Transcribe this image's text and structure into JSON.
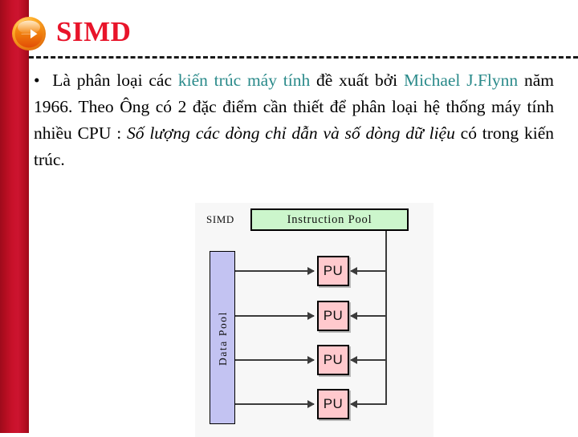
{
  "slide": {
    "title": "SIMD",
    "bullet_icon": "arrow-right-circle-icon",
    "accent_color": "#c8112a",
    "title_color": "#e8142a",
    "link_color": "#2a8a8a"
  },
  "body": {
    "bullet": "•",
    "runs": [
      {
        "text": "Là phân loại các ",
        "style": "normal"
      },
      {
        "text": "kiến trúc máy tính",
        "style": "teal"
      },
      {
        "text": " đề xuất bởi ",
        "style": "normal"
      },
      {
        "text": "Michael J.Flynn",
        "style": "teal"
      },
      {
        "text": " năm 1966. Theo Ông có 2 đặc điểm cần thiết để phân loại hệ thống máy tính nhiều CPU : ",
        "style": "normal"
      },
      {
        "text": "Số lượng các dòng chỉ dẫn và số dòng dữ liệu",
        "style": "italic"
      },
      {
        "text": " có trong kiến trúc.",
        "style": "normal"
      }
    ],
    "full_text": "• Là phân loại các kiến trúc máy tính đề xuất bởi Michael J.Flynn năm 1966. Theo Ông có 2 đặc điểm cần thiết để phân loại hệ thống máy tính nhiều CPU : Số lượng các dòng chỉ dẫn và số dòng dữ liệu có trong kiến trúc."
  },
  "diagram": {
    "caption": "SIMD",
    "instruction_pool": {
      "label": "Instruction Pool",
      "color": "#ccf6cc"
    },
    "data_pool": {
      "label": "Data Pool",
      "color": "#c3c3f2"
    },
    "processing_units": [
      {
        "label": "PU",
        "color": "#ffc9cd"
      },
      {
        "label": "PU",
        "color": "#ffc9cd"
      },
      {
        "label": "PU",
        "color": "#ffc9cd"
      },
      {
        "label": "PU",
        "color": "#ffc9cd"
      }
    ],
    "background": "#f7f7f7"
  }
}
